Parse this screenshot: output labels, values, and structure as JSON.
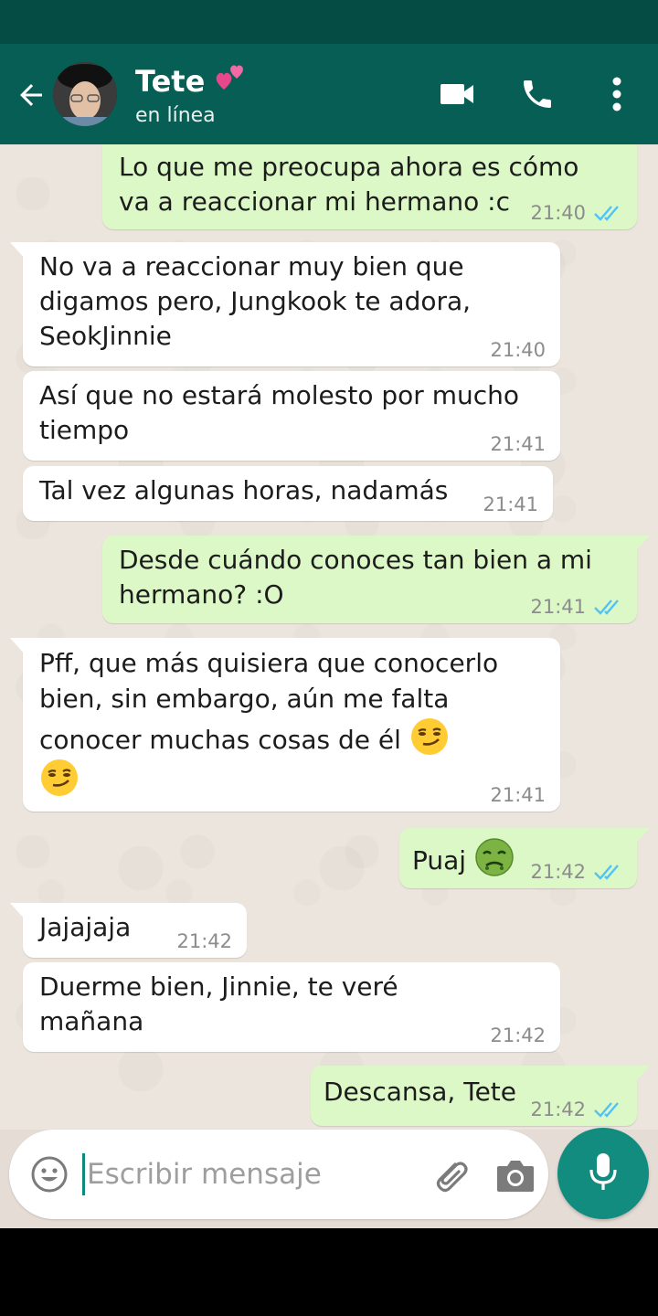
{
  "header": {
    "contact_name": "Tete",
    "contact_emoji": "two-hearts",
    "status": "en línea",
    "icons": [
      "back-arrow-icon",
      "video-call-icon",
      "voice-call-icon",
      "more-options-icon"
    ]
  },
  "messages": [
    {
      "direction": "out",
      "text": "Lo que me preocupa ahora es cómo\nva a reaccionar mi hermano :c",
      "time": "21:40",
      "read": true
    },
    {
      "direction": "in",
      "text": "No va a reaccionar muy bien que\ndigamos pero, Jungkook te adora,\nSeokJinnie",
      "time": "21:40"
    },
    {
      "direction": "in",
      "text": "Así que no estará molesto por mucho\ntiempo",
      "time": "21:41"
    },
    {
      "direction": "in",
      "text": "Tal vez algunas horas, nadamás",
      "time": "21:41"
    },
    {
      "direction": "out",
      "text": "Desde cuándo conoces tan bien a mi\nhermano? :O",
      "time": "21:41",
      "read": true
    },
    {
      "direction": "in",
      "text": "Pff, que más quisiera que conocerlo\nbien, sin embargo, aún me falta\nconocer muchas cosas de él",
      "emoji": "smirking-face",
      "time": "21:41"
    },
    {
      "direction": "out",
      "text": "Puaj",
      "emoji": "nauseated-face",
      "time": "21:42",
      "read": true
    },
    {
      "direction": "in",
      "text": "Jajajaja",
      "time": "21:42"
    },
    {
      "direction": "in",
      "text": "Duerme bien, Jinnie, te veré\nmañana",
      "time": "21:42"
    },
    {
      "direction": "out",
      "text": "Descansa, Tete",
      "time": "21:42",
      "read": true
    }
  ],
  "composer": {
    "placeholder": "Escribir mensaje",
    "icons": [
      "emoji-icon",
      "attach-icon",
      "camera-icon",
      "mic-icon"
    ]
  },
  "colors": {
    "header": "#075e54",
    "status_bar": "#054d44",
    "outgoing_bubble": "#dcf8c6",
    "incoming_bubble": "#ffffff",
    "read_ticks": "#4fc3f7",
    "mic_button": "#128c7e"
  }
}
